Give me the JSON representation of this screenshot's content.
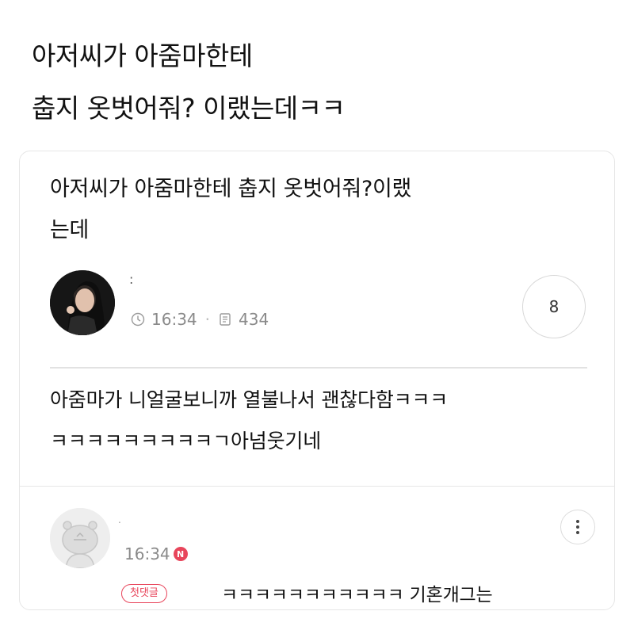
{
  "headline": {
    "line1": "아저씨가 아줌마한테",
    "line2": "춥지 옷벗어줘? 이랬는데ㅋㅋ"
  },
  "post": {
    "title_line1": "아저씨가 아줌마한테 춥지 옷벗어줘?이랬",
    "title_line2": "는데",
    "author_mark": ":",
    "time": "16:34",
    "views": "434",
    "comment_count": "8",
    "body_line1": "아줌마가 니얼굴보니까 열불나서 괜찮다함ㅋㅋㅋ",
    "body_line2": "ㅋㅋㅋㅋㅋㅋㅋㅋㅋㄱ아넘웃기네",
    "icons": {
      "time": "clock-icon",
      "views": "document-icon"
    }
  },
  "comment": {
    "author_mark": ".",
    "time": "16:34",
    "new_badge": "N",
    "first_badge": "첫댓글",
    "text": "ㅋㅋㅋㅋㅋㅋㅋㅋㅋㅋㅋ 기혼개그는",
    "more_icon": "more-vertical-icon"
  },
  "colors": {
    "accent_red": "#e8455b",
    "meta_gray": "#8a8a8a",
    "divider": "#e2e2e2"
  }
}
